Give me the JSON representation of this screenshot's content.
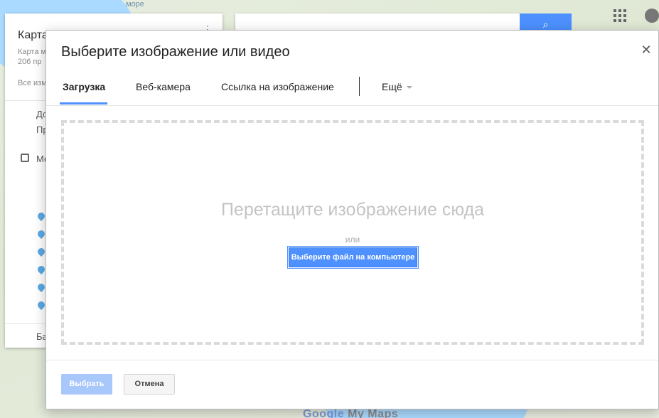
{
  "background": {
    "sea_label": "море",
    "logo_google": "Google",
    "logo_mymaps": "My Maps",
    "side_panel": {
      "title": "Карта",
      "line1": "Карта м",
      "line2": "206 пр",
      "line3": "Все изм",
      "row1": "До",
      "row2": "Пр",
      "row3": "Мо",
      "row4": "Ба"
    }
  },
  "dialog": {
    "title": "Выберите изображение или видео",
    "close_icon": "close-icon",
    "tabs": [
      {
        "label": "Загрузка",
        "active": true
      },
      {
        "label": "Веб-камера",
        "active": false
      },
      {
        "label": "Ссылка на изображение",
        "active": false
      },
      {
        "label": "Ещё",
        "active": false
      }
    ],
    "dropzone": {
      "text": "Перетащите изображение сюда",
      "or": "или",
      "choose_button": "Выберите файл на компьютере"
    },
    "footer": {
      "select_label": "Выбрать",
      "cancel_label": "Отмена"
    }
  },
  "colors": {
    "accent": "#4d90fe",
    "disabled_primary": "#a8c7fa"
  }
}
